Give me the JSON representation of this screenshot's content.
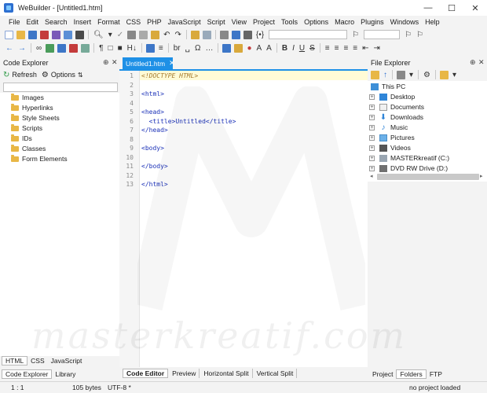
{
  "window": {
    "title": "WeBuilder - [Untitled1.htm]",
    "minimize": "—",
    "maximize": "☐",
    "close": "✕"
  },
  "menu": [
    "File",
    "Edit",
    "Search",
    "Insert",
    "Format",
    "CSS",
    "PHP",
    "JavaScript",
    "Script",
    "View",
    "Project",
    "Tools",
    "Options",
    "Macro",
    "Plugins",
    "Windows",
    "Help"
  ],
  "toolbar2": {
    "heading": "H↓",
    "br": "br",
    "omega": "Ω",
    "bold": "B",
    "italic": "I",
    "underline": "U",
    "strike": "S"
  },
  "code_explorer": {
    "title": "Code Explorer",
    "pin": "⊕",
    "close": "✕",
    "refresh_label": "Refresh",
    "options_label": "Options",
    "items": [
      "Images",
      "Hyperlinks",
      "Style Sheets",
      "Scripts",
      "IDs",
      "Classes",
      "Form Elements"
    ],
    "lang_tabs": [
      "HTML",
      "CSS",
      "JavaScript"
    ],
    "panel_tabs": [
      "Code Explorer",
      "Library"
    ]
  },
  "editor": {
    "tab_label": "Untitled1.htm",
    "tab_close": "✕",
    "line_numbers": [
      "1",
      "2",
      "3",
      "4",
      "5",
      "6",
      "7",
      "8",
      "9",
      "10",
      "11",
      "12",
      "13"
    ],
    "lines": [
      "<!DOCTYPE HTML>",
      "",
      "<html>",
      "",
      "<head>",
      "  <title>Untitled</title>",
      "</head>",
      "",
      "<body>",
      "",
      "</body>",
      "",
      "</html>"
    ],
    "view_tabs": [
      "Code Editor",
      "Preview",
      "Horizontal Split",
      "Vertical Split"
    ]
  },
  "file_explorer": {
    "title": "File Explorer",
    "pin": "⊕",
    "close": "✕",
    "root": "This PC",
    "items": [
      "Desktop",
      "Documents",
      "Downloads",
      "Music",
      "Pictures",
      "Videos",
      "MASTERkreatif (C:)",
      "DVD RW Drive (D:)"
    ],
    "panel_tabs": [
      "Project",
      "Folders",
      "FTP"
    ]
  },
  "status": {
    "position": "1 : 1",
    "size": "105 bytes",
    "encoding": "UTF-8 *",
    "project": "no project loaded"
  },
  "watermark": "masterkreatif.com",
  "colors": {
    "accent": "#1e90e6",
    "folder": "#e8b746",
    "tag": "#1c32b8",
    "current_line": "#fffbd6"
  }
}
